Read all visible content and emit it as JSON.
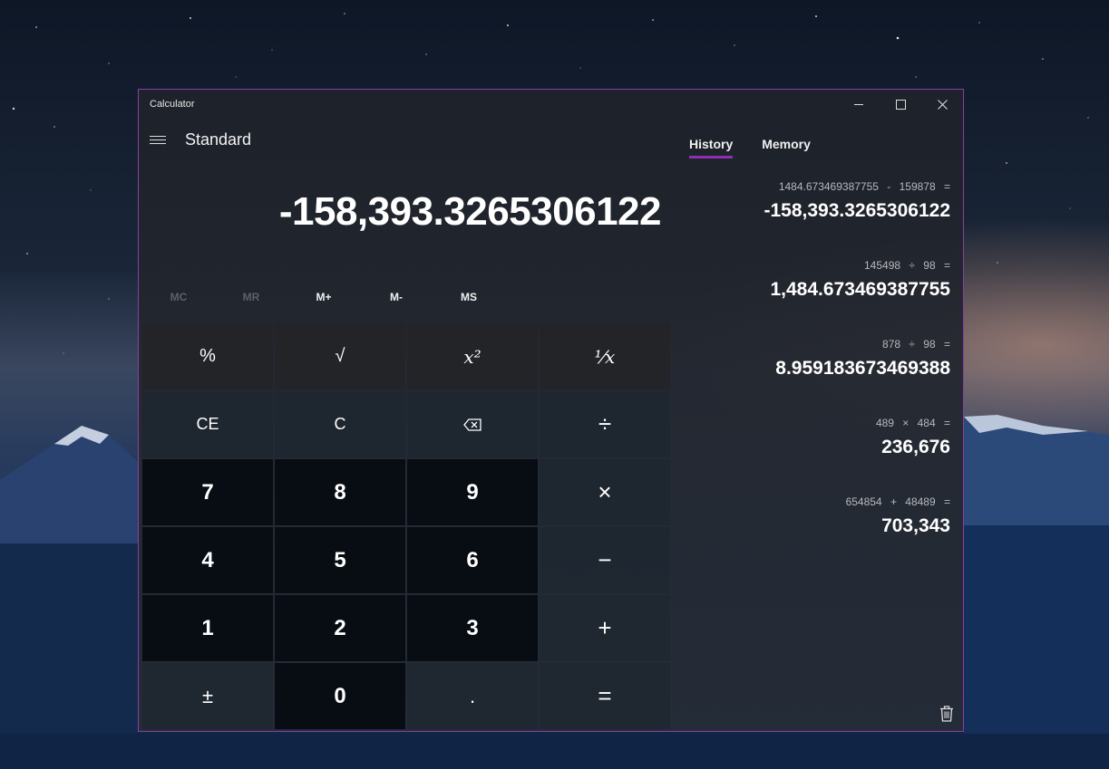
{
  "window": {
    "title": "Calculator",
    "controls": {
      "minimize": "—",
      "maximize": "☐",
      "close": "✕"
    }
  },
  "header": {
    "mode": "Standard"
  },
  "display": {
    "value": "-158,393.3265306122"
  },
  "memory": {
    "buttons": [
      {
        "label": "MC",
        "enabled": false
      },
      {
        "label": "MR",
        "enabled": false
      },
      {
        "label": "M+",
        "enabled": true
      },
      {
        "label": "M-",
        "enabled": true
      },
      {
        "label": "MS",
        "enabled": true
      }
    ]
  },
  "keypad": {
    "percent": "%",
    "sqrt": "√",
    "square": "x²",
    "reciprocal": "¹⁄x",
    "ce": "CE",
    "clear": "C",
    "backspace": "⌫",
    "divide": "÷",
    "seven": "7",
    "eight": "8",
    "nine": "9",
    "multiply": "×",
    "four": "4",
    "five": "5",
    "six": "6",
    "minus": "−",
    "one": "1",
    "two": "2",
    "three": "3",
    "plus": "+",
    "negate": "±",
    "zero": "0",
    "decimal": ".",
    "equals": "="
  },
  "panel": {
    "tabs": [
      "History",
      "Memory"
    ],
    "active_tab": "History",
    "history": [
      {
        "expression": "1484.673469387755 - 159878 =",
        "result": "-158,393.3265306122"
      },
      {
        "expression": "145498 ÷ 98 =",
        "result": "1,484.673469387755"
      },
      {
        "expression": "878 ÷ 98 =",
        "result": "8.959183673469388"
      },
      {
        "expression": "489 × 484 =",
        "result": "236,676"
      },
      {
        "expression": "654854 + 48489 =",
        "result": "703,343"
      }
    ]
  }
}
